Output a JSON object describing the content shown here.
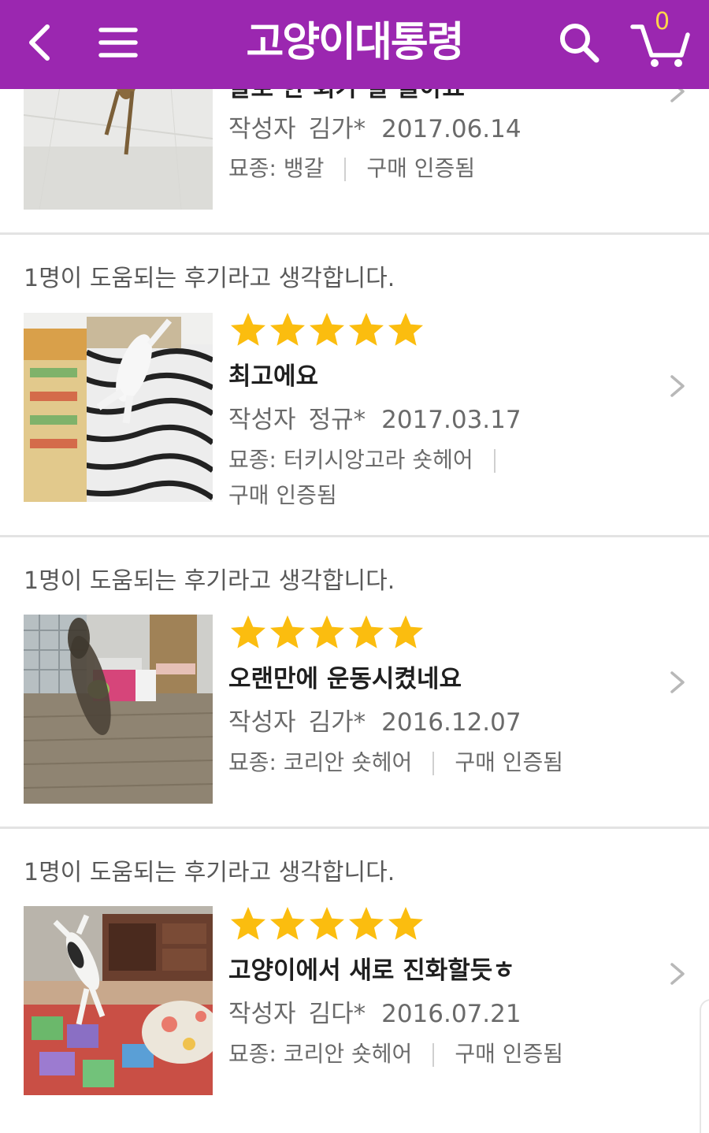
{
  "header": {
    "title": "고양이대통령",
    "cart_count": "0",
    "back_icon": "chevron-left-icon",
    "menu_icon": "hamburger-menu-icon",
    "search_icon": "search-icon",
    "cart_icon": "cart-icon",
    "bg_color": "#9b27b0"
  },
  "colors": {
    "star": "#fbbd0f",
    "divider": "#e3e3e3"
  },
  "reviews": [
    {
      "title": "발로 한 회가 잘 놀아요",
      "author_label": "작성자",
      "author": "김가*",
      "date": "2017.06.14",
      "breed_label": "묘종: 뱅갈",
      "verified": "구매 인증됨",
      "image": "bengal-cat-photo"
    },
    {
      "helpful": "1명이 도움되는 후기라고 생각합니다.",
      "rating": 5,
      "title": "최고에요",
      "author_label": "작성자",
      "author": "정규*",
      "date": "2017.03.17",
      "breed_label": "묘종: 터키시앙고라 숏헤어",
      "verified": "구매 인증됨",
      "image": "white-cat-jumping-photo"
    },
    {
      "helpful": "1명이 도움되는 후기라고 생각합니다.",
      "rating": 5,
      "title": "오랜만에 운동시켰네요",
      "author_label": "작성자",
      "author": "김가*",
      "date": "2016.12.07",
      "breed_label": "묘종: 코리안 숏헤어",
      "verified": "구매 인증됨",
      "image": "tabby-cat-jumping-photo"
    },
    {
      "helpful": "1명이 도움되는 후기라고 생각합니다.",
      "rating": 5,
      "title": "고양이에서 새로 진화할듯ㅎ",
      "author_label": "작성자",
      "author": "김다*",
      "date": "2016.07.21",
      "breed_label": "묘종: 코리안 숏헤어",
      "verified": "구매 인증됨",
      "image": "calico-cat-leaping-photo"
    }
  ]
}
